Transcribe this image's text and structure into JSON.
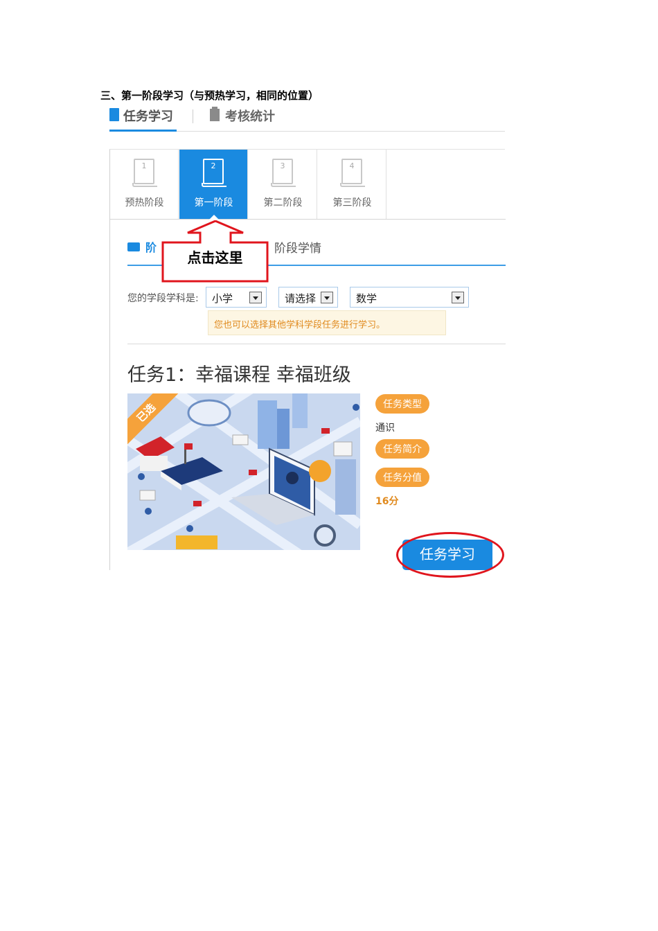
{
  "heading": "三、第一阶段学习（与预热学习，相同的位置）",
  "topnav": {
    "tab_active": "任务学习",
    "tab_other": "考核统计"
  },
  "steps": [
    {
      "num": "1",
      "label": "预热阶段"
    },
    {
      "num": "2",
      "label": "第一阶段"
    },
    {
      "num": "3",
      "label": "第二阶段"
    },
    {
      "num": "4",
      "label": "第三阶段"
    }
  ],
  "subtabs": {
    "a": "阶",
    "b": "阶段学情"
  },
  "annotation": {
    "text": "点击这里",
    "color": "#e0151d"
  },
  "selector": {
    "label": "您的学段学科是:",
    "stage": "小学",
    "grade": "请选择",
    "subject": "数学",
    "hint": "您也可以选择其他学科学段任务进行学习。"
  },
  "task": {
    "title": "任务1：幸福课程 幸福班级",
    "badge": "已选",
    "type_label": "任务类型",
    "type_value": "通识",
    "intro_label": "任务简介",
    "score_label": "任务分值",
    "score_value": "16分",
    "study_button": "任务学习"
  },
  "colors": {
    "accent": "#1a8ae0",
    "orange": "#f5a23b",
    "red": "#e0151d"
  }
}
